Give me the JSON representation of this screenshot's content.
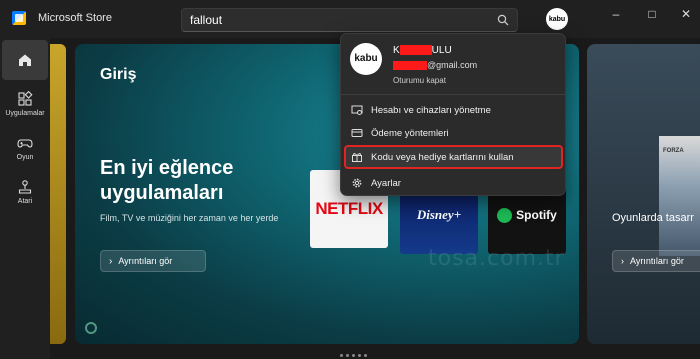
{
  "app": {
    "title": "Microsoft Store",
    "search": {
      "value": "fallout",
      "placeholder": ""
    },
    "avatar_text": "kabu",
    "window_controls": {
      "minimize": "–",
      "maximize": "□",
      "close": "✕"
    }
  },
  "sidebar": {
    "items": [
      {
        "label": "",
        "icon": "home-icon",
        "active": true
      },
      {
        "label": "Uygulamalar",
        "icon": "apps-icon",
        "active": false
      },
      {
        "label": "Oyun",
        "icon": "gamepad-icon",
        "active": false
      },
      {
        "label": "Atari",
        "icon": "joystick-icon",
        "active": false
      }
    ]
  },
  "hero": {
    "section_title": "Giriş",
    "headline": "En iyi eğlence uygulamaları",
    "subtitle": "Film, TV ve müziğini her zaman ve her yerde",
    "button_label": "Ayrıntıları gör",
    "tiles": [
      "NETFLIX",
      "Disney+",
      "Spotify"
    ]
  },
  "right_card": {
    "title": "Oyunlarda tasarr",
    "button_label": "Ayrıntıları gör"
  },
  "watermark": "tosa.com.tr",
  "account_menu": {
    "avatar_text": "kabu",
    "name_visible": "K",
    "name_suffix": "ULU",
    "email_suffix": "@gmail.com",
    "sign_out": "Oturumu kapat",
    "items": [
      {
        "label": "Hesabı ve cihazları yönetme",
        "icon": "device-account-icon"
      },
      {
        "label": "Ödeme yöntemleri",
        "icon": "credit-card-icon"
      },
      {
        "label": "Kodu veya hediye kartlarını kullan",
        "icon": "gift-icon",
        "highlighted": true
      },
      {
        "label": "Ayarlar",
        "icon": "gear-icon"
      }
    ]
  },
  "colors": {
    "highlight_box": "#e02424",
    "redaction": "#ff1a1a",
    "hero_teal": "#0f6672"
  }
}
